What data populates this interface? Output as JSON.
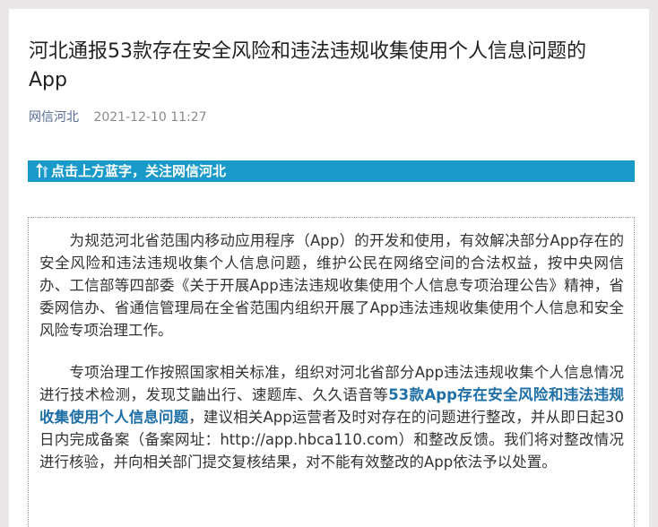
{
  "article": {
    "title": "河北通报53款存在安全风险和违法违规收集使用个人信息问题的App",
    "author": "网信河北",
    "date": "2021-12-10 11:27"
  },
  "banner": {
    "arrow_icon": "up-arrow-icon",
    "text": "点击上方蓝字，关注网信河北",
    "color": "#1a9ac9"
  },
  "body": {
    "p1": "　　为规范河北省范围内移动应用程序（App）的开发和使用，有效解决部分App存在的安全风险和违法违规收集个人信息问题，维护公民在网络空间的合法权益，按中央网信办、工信部等四部委《关于开展App违法违规收集使用个人信息专项治理公告》精神，省委网信办、省通信管理局在全省范围内组织开展了App违法违规收集使用个人信息和安全风险专项治理工作。",
    "p2_part1": "　　专项治理工作按照国家相关标准，组织对河北省部分App违法违规收集个人信息情况进行技术检测，发现艾鼬出行、速题库、久久语音等",
    "p2_highlight": "53款App存在安全风险和违法违规收集使用个人信息问题",
    "p2_part2": "，建议相关App运营者及时对存在的问题进行整改，并从即日起30日内完成备案（备案网址：http://app.hbca110.com）和整改反馈。我们将对整改情况进行核验，并向相关部门提交复核结果，对不能有效整改的App依法予以处置。",
    "highlight_color": "#1e6fa6"
  }
}
